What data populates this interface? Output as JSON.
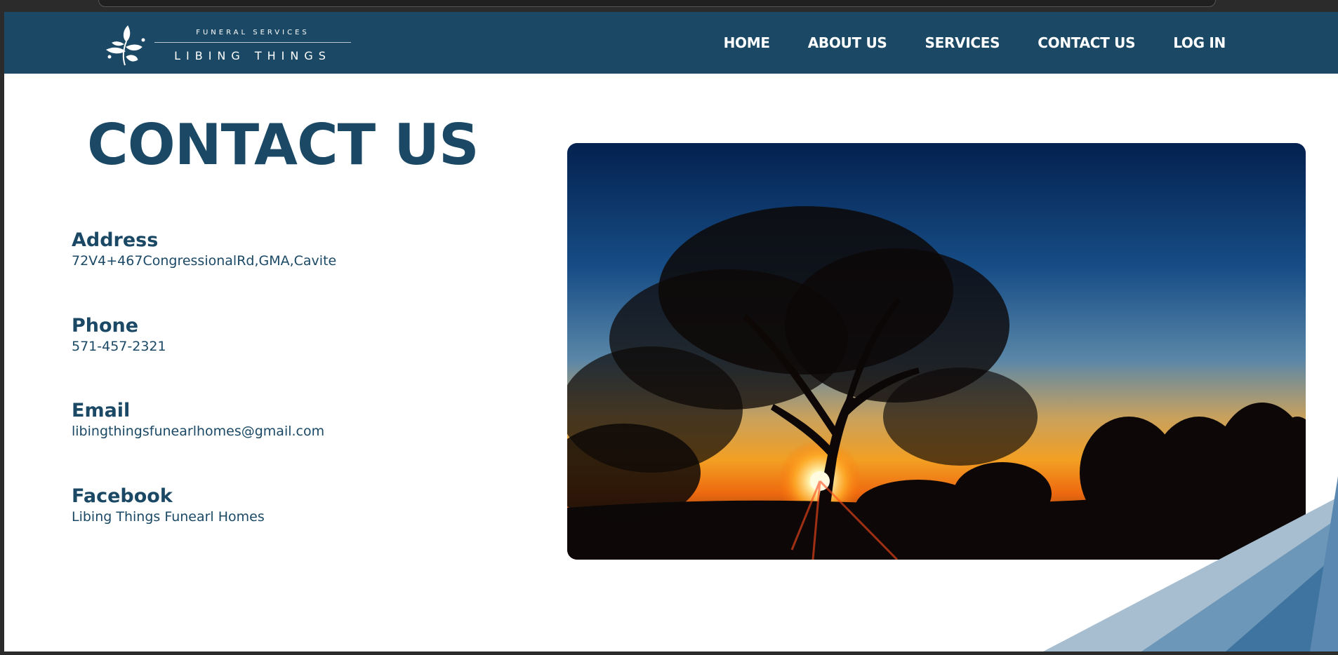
{
  "brand": {
    "tagline": "FUNERAL SERVICES",
    "name": "LIBING THINGS"
  },
  "nav": {
    "items": [
      {
        "label": "HOME"
      },
      {
        "label": "ABOUT US"
      },
      {
        "label": "SERVICES"
      },
      {
        "label": "CONTACT US"
      },
      {
        "label": "LOG IN"
      }
    ]
  },
  "main": {
    "title": "CONTACT US",
    "contacts": [
      {
        "label": "Address",
        "value": "72V4+467CongressionalRd,GMA,Cavite"
      },
      {
        "label": "Phone",
        "value": "571-457-2321"
      },
      {
        "label": "Email",
        "value": "libingthingsfunearlhomes@gmail.com"
      },
      {
        "label": "Facebook",
        "value": "Libing Things Funearl Homes"
      }
    ]
  },
  "colors": {
    "brand_navy": "#1b4965",
    "page_bg": "#ffffff"
  },
  "icons": {
    "logo": "leaf-branch-icon"
  }
}
